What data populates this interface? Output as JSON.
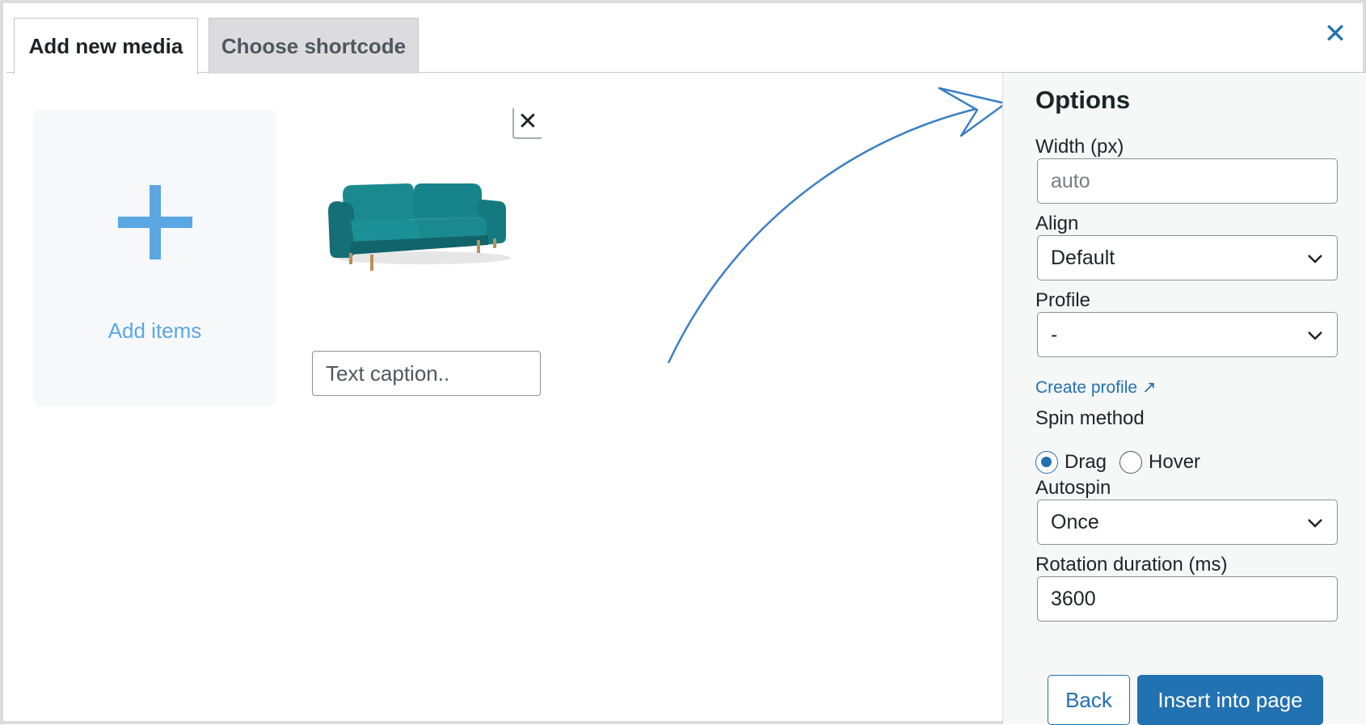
{
  "tabs": [
    {
      "label": "Add new media",
      "active": true
    },
    {
      "label": "Choose shortcode",
      "active": false
    }
  ],
  "close_icon": "close-icon",
  "media": {
    "add_tile_label": "Add items",
    "item": {
      "image": "teal sofa",
      "caption_placeholder": "Text caption..",
      "caption_value": ""
    }
  },
  "options": {
    "title": "Options",
    "width": {
      "label": "Width (px)",
      "placeholder": "auto",
      "value": ""
    },
    "align": {
      "label": "Align",
      "value": "Default"
    },
    "profile": {
      "label": "Profile",
      "value": "-",
      "link": "Create profile ↗"
    },
    "spin_method": {
      "label": "Spin method",
      "options": [
        "Drag",
        "Hover"
      ],
      "selected": "Drag"
    },
    "autospin": {
      "label": "Autospin",
      "value": "Once"
    },
    "rotation_duration": {
      "label": "Rotation duration (ms)",
      "value": "3600"
    },
    "buttons": {
      "back": "Back",
      "insert": "Insert into page"
    }
  },
  "colors": {
    "accent": "#2271b1",
    "add_accent": "#5aa7e4",
    "sofa": "#157f86"
  }
}
